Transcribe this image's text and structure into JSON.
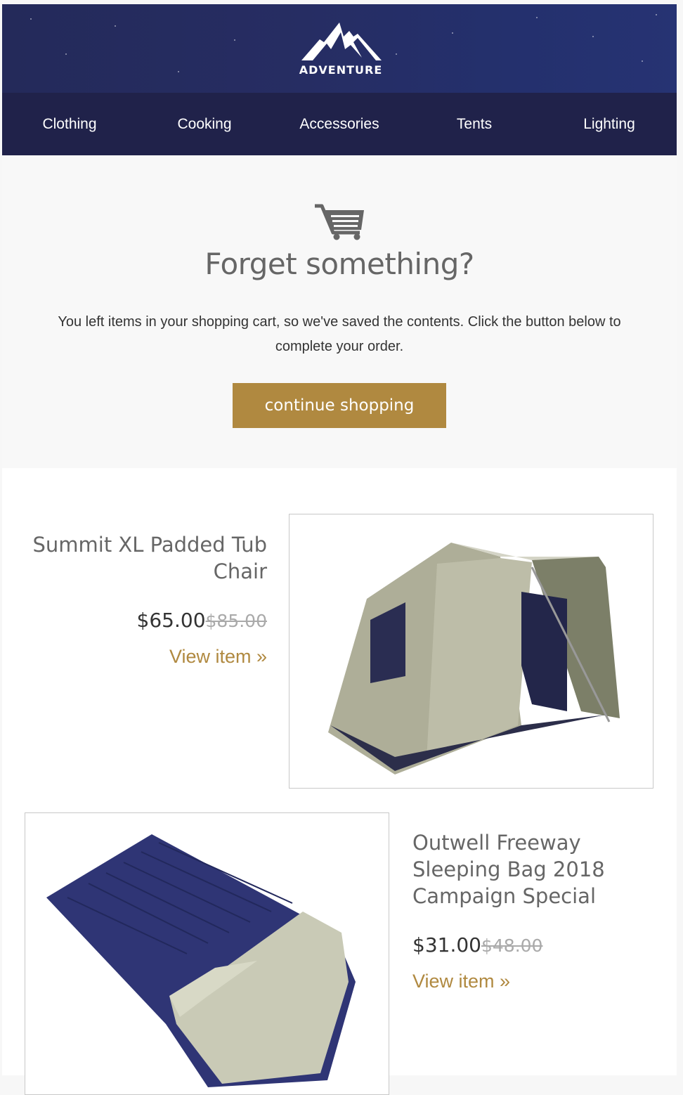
{
  "brand": {
    "name": "ADVENTURE",
    "logo_icon": "mountain-icon"
  },
  "nav": {
    "items": [
      {
        "label": "Clothing"
      },
      {
        "label": "Cooking"
      },
      {
        "label": "Accessories"
      },
      {
        "label": "Tents"
      },
      {
        "label": "Lighting"
      }
    ]
  },
  "intro": {
    "icon": "shopping-cart-icon",
    "title": "Forget something?",
    "body": "You left items in your shopping cart, so we've saved the contents. Click the button below to complete your order.",
    "cta_label": "continue shopping"
  },
  "products": [
    {
      "name": "Summit XL Padded Tub Chair",
      "price": "$65.00",
      "original_price": "$85.00",
      "link_label": "View item »",
      "image": "tent-image"
    },
    {
      "name": "Outwell Freeway Sleeping Bag 2018 Campaign Special",
      "price": "$31.00",
      "original_price": "$48.00",
      "link_label": "View item »",
      "image": "sleeping-bag-image"
    }
  ],
  "colors": {
    "header_bg": "#262d63",
    "nav_bg": "#20224a",
    "accent": "#b08940",
    "heading": "#666666",
    "text": "#333333",
    "strike": "#aaaaaa"
  }
}
